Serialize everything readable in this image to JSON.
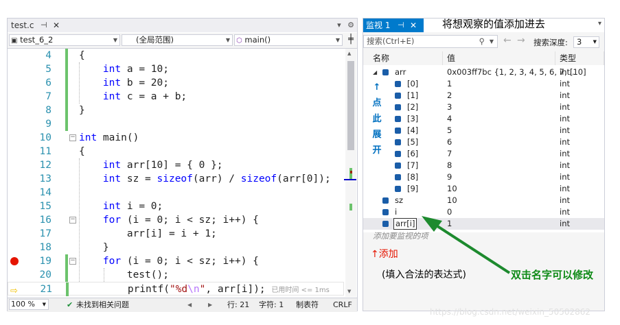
{
  "editor": {
    "tab_title": "test.c",
    "tab_pin": "⊣",
    "tab_close": "✕",
    "project_combo": "test_6_2",
    "scope_combo": "(全局范围)",
    "function_combo": "main()",
    "zoom": "100 %",
    "issues": "未找到相关问题",
    "status_line": "行: 21",
    "status_char": "字符: 1",
    "status_tab": "制表符",
    "status_eol": "CRLF",
    "elapsed_hint": "已用时间 <= 1ms",
    "lines": [
      {
        "num": "4",
        "text": "{"
      },
      {
        "num": "5",
        "text": "    int a = 10;"
      },
      {
        "num": "6",
        "text": "    int b = 20;"
      },
      {
        "num": "7",
        "text": "    int c = a + b;"
      },
      {
        "num": "8",
        "text": "}"
      },
      {
        "num": "9",
        "text": ""
      },
      {
        "num": "10",
        "text": "int main()"
      },
      {
        "num": "11",
        "text": "{"
      },
      {
        "num": "12",
        "text": "    int arr[10] = { 0 };"
      },
      {
        "num": "13",
        "text": "    int sz = sizeof(arr) / sizeof(arr[0]);"
      },
      {
        "num": "14",
        "text": ""
      },
      {
        "num": "15",
        "text": "    int i = 0;"
      },
      {
        "num": "16",
        "text": "    for (i = 0; i < sz; i++) {"
      },
      {
        "num": "17",
        "text": "        arr[i] = i + 1;"
      },
      {
        "num": "18",
        "text": "    }"
      },
      {
        "num": "19",
        "text": "    for (i = 0; i < sz; i++) {"
      },
      {
        "num": "20",
        "text": "        test();"
      },
      {
        "num": "21",
        "text": "        printf(\"%d\\n\", arr[i]);"
      }
    ]
  },
  "watch": {
    "tab_title": "监视 1",
    "tab_pin": "⊣",
    "tab_close": "✕",
    "search_placeholder": "搜索(Ctrl+E)",
    "search_depth_label": "搜索深度:",
    "search_depth_value": "3",
    "col_name": "名称",
    "col_value": "值",
    "col_type": "类型",
    "rows": [
      {
        "name": "arr",
        "value": "0x003ff7bc {1, 2, 3, 4, 5, 6, 7, ...",
        "type": "int[10]"
      },
      {
        "name": "[0]",
        "value": "1",
        "type": "int"
      },
      {
        "name": "[1]",
        "value": "2",
        "type": "int"
      },
      {
        "name": "[2]",
        "value": "3",
        "type": "int"
      },
      {
        "name": "[3]",
        "value": "4",
        "type": "int"
      },
      {
        "name": "[4]",
        "value": "5",
        "type": "int"
      },
      {
        "name": "[5]",
        "value": "6",
        "type": "int"
      },
      {
        "name": "[6]",
        "value": "7",
        "type": "int"
      },
      {
        "name": "[7]",
        "value": "8",
        "type": "int"
      },
      {
        "name": "[8]",
        "value": "9",
        "type": "int"
      },
      {
        "name": "[9]",
        "value": "10",
        "type": "int"
      },
      {
        "name": "sz",
        "value": "10",
        "type": "int"
      },
      {
        "name": "i",
        "value": "0",
        "type": "int"
      },
      {
        "name": "arr[i]",
        "value": "1",
        "type": "int"
      }
    ],
    "add_item_hint": "添加要监视的项"
  },
  "annotations": {
    "top_note": "将想观察的值添加进去",
    "expand_note": [
      "↑",
      "点",
      "此",
      "展",
      "开"
    ],
    "add_note": "↑添加",
    "expr_note": "(填入合法的表达式)",
    "rename_note": "双击名字可以修改",
    "watermark": "https://blog.csdn.net/weixin_50502862"
  },
  "colors": {
    "accent_blue": "#007acc",
    "annotation_blue": "#0000ff",
    "annotation_red": "#e51400",
    "annotation_green": "#0e8a16",
    "change_bar_green": "#6cc36c",
    "breakpoint_red": "#e51400"
  },
  "icons": [
    "pin-icon",
    "close-icon",
    "dropdown-icon",
    "search-icon",
    "back-arrow-icon",
    "forward-arrow-icon",
    "breakpoint-icon",
    "instruction-pointer-icon",
    "variable-cube-icon",
    "expand-triangle-icon",
    "check-icon"
  ]
}
